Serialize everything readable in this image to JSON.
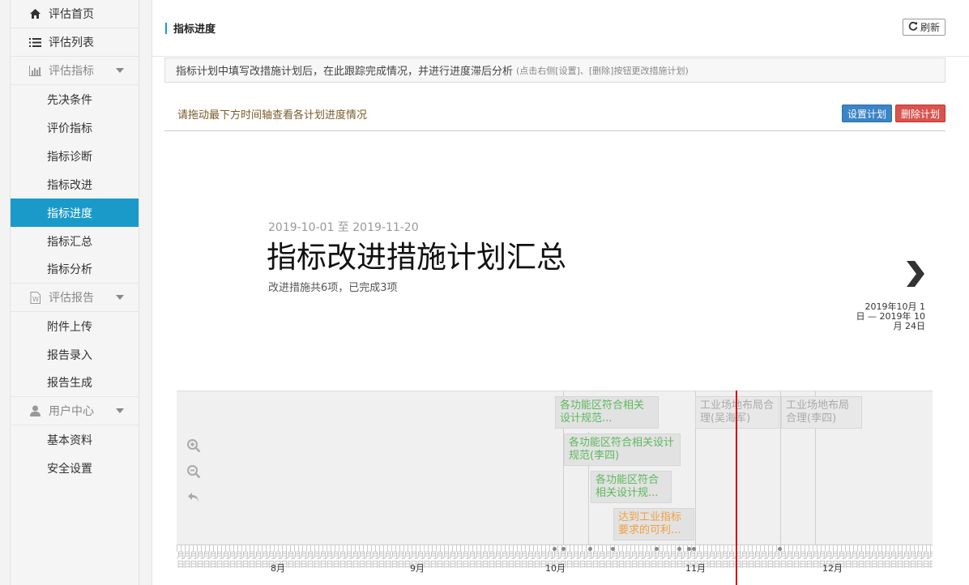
{
  "sidebar": {
    "home": "评估首页",
    "list": "评估列表",
    "indicator_section": "评估指标",
    "indicator_items": [
      "先决条件",
      "评价指标",
      "指标诊断",
      "指标改进",
      "指标进度",
      "指标汇总",
      "指标分析"
    ],
    "report_section": "评估报告",
    "report_items": [
      "附件上传",
      "报告录入",
      "报告生成"
    ],
    "user_section": "用户中心",
    "user_items": [
      "基本资料",
      "安全设置"
    ]
  },
  "header": {
    "title": "指标进度",
    "refresh_label": "刷新"
  },
  "notice": {
    "text": "指标计划中填写改措施计划后，在此跟踪完成情况，并进行进度滞后分析",
    "hint": "(点击右侧[设置]、[删除]按钮更改措施计划)"
  },
  "toolbar": {
    "drag_tip": "请拖动最下方时间轴查看各计划进度情况",
    "set_plan": "设置计划",
    "delete_plan": "删除计划"
  },
  "slide": {
    "date_range": "2019-10-01 至 2019-11-20",
    "title": "指标改进措施计划汇总",
    "description": "改进措施共6项，已完成3项",
    "next_range": "2019年10月 1 日 — 2019年 10月 24日"
  },
  "timeline": {
    "events": [
      {
        "label": "各功能区符合相关设计规范...",
        "status": "green"
      },
      {
        "label": "各功能区符合相关设计规范(李四)",
        "status": "green"
      },
      {
        "label": "各功能区符合相关设计规...",
        "status": "green"
      },
      {
        "label": "达到工业指标要求的可利...",
        "status": "orange"
      },
      {
        "label": "工业场地布局合理(吴海军)",
        "status": "gray"
      },
      {
        "label": "工业场地布局合理(李四)",
        "status": "gray"
      }
    ],
    "months": [
      "8月",
      "9月",
      "10月",
      "11月",
      "12月"
    ],
    "scrap_text": "月月月月月月月月月月月月月月月月月月月月月月月月月月月月月月月月月月月月月月月月月月月月月月月月月月月月月月月月月月月月月月月月月月月月月月月月月月月月月月月月月月月月月月月月月月月月月月月月月月月月月月月月月月月月月月月月月月月月月月月月月月月月月月月月月月月月月月月月",
    "scrap_text2": "日日日日日日日日日日日日日日日日日日日日日日日日日日日日日日日日日日日日日日日日日日日日日日日日日日日日日日日日日日日日日日日日日日日日日日日日日日日日日日日日日日日日日日日日日日日日日日日日日日日日日日日日日日日日日日日日日日日日日日日日日日日日日日日日"
  },
  "colors": {
    "accent": "#1a9ac9",
    "primary_button": "#3a84c7",
    "danger_button": "#d9534f",
    "done": "#5cb85c",
    "late": "#f0a040",
    "now_line": "#cc0000"
  }
}
